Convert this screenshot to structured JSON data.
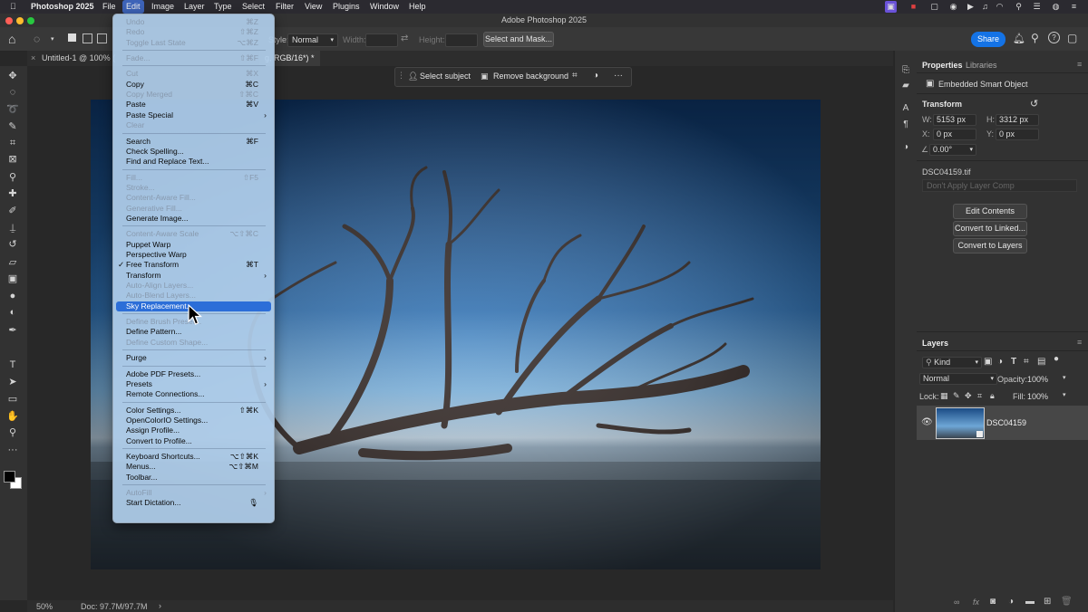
{
  "menubar": {
    "app": "Photoshop 2025",
    "items": [
      "File",
      "Edit",
      "Image",
      "Layer",
      "Type",
      "Select",
      "Filter",
      "View",
      "Plugins",
      "Window",
      "Help"
    ],
    "active": "Edit",
    "window_title": "Adobe Photoshop 2025"
  },
  "optionsbar": {
    "style_label": "Style:",
    "style_value": "Normal",
    "width_label": "Width:",
    "height_label": "Height:",
    "select_mask": "Select and Mask...",
    "share": "Share"
  },
  "document_tabs": [
    {
      "label": "Untitled-1 @ 100% (",
      "active": false
    },
    {
      "label": "g, RGB/16*) *",
      "active": true
    }
  ],
  "taskbar": {
    "select_subject": "Select subject",
    "remove_background": "Remove background"
  },
  "statusbar": {
    "zoom": "50%",
    "doc": "Doc: 97.7M/97.7M"
  },
  "properties": {
    "tabs": [
      "Properties",
      "Libraries"
    ],
    "object_type": "Embedded Smart Object",
    "section": "Transform",
    "w_label": "W:",
    "w_value": "5153 px",
    "h_label": "H:",
    "h_value": "3312 px",
    "x_label": "X:",
    "x_value": "0 px",
    "y_label": "Y:",
    "y_value": "0 px",
    "angle_value": "0.00°",
    "filename": "DSC04159.tif",
    "layer_comp": "Don't Apply Layer Comp",
    "buttons": [
      "Edit Contents",
      "Convert to Linked...",
      "Convert to Layers"
    ]
  },
  "layers": {
    "title": "Layers",
    "filter": "Kind",
    "blend_mode": "Normal",
    "opacity_label": "Opacity:",
    "opacity_value": "100%",
    "lock_label": "Lock:",
    "fill_label": "Fill:",
    "fill_value": "100%",
    "layer_name": "DSC04159"
  },
  "edit_menu": [
    {
      "label": "Undo",
      "shortcut": "⌘Z",
      "disabled": true
    },
    {
      "label": "Redo",
      "shortcut": "⇧⌘Z",
      "disabled": true
    },
    {
      "label": "Toggle Last State",
      "shortcut": "⌥⌘Z",
      "disabled": true
    },
    {
      "sep": true
    },
    {
      "label": "Fade...",
      "shortcut": "⇧⌘F",
      "disabled": true
    },
    {
      "sep": true
    },
    {
      "label": "Cut",
      "shortcut": "⌘X",
      "disabled": true
    },
    {
      "label": "Copy",
      "shortcut": "⌘C"
    },
    {
      "label": "Copy Merged",
      "shortcut": "⇧⌘C",
      "disabled": true
    },
    {
      "label": "Paste",
      "shortcut": "⌘V"
    },
    {
      "label": "Paste Special",
      "submenu": true
    },
    {
      "label": "Clear",
      "disabled": true
    },
    {
      "sep": true
    },
    {
      "label": "Search",
      "shortcut": "⌘F"
    },
    {
      "label": "Check Spelling..."
    },
    {
      "label": "Find and Replace Text..."
    },
    {
      "sep": true
    },
    {
      "label": "Fill...",
      "shortcut": "⇧F5",
      "disabled": true
    },
    {
      "label": "Stroke...",
      "disabled": true
    },
    {
      "label": "Content-Aware Fill...",
      "disabled": true
    },
    {
      "label": "Generative Fill...",
      "disabled": true
    },
    {
      "label": "Generate Image..."
    },
    {
      "sep": true
    },
    {
      "label": "Content-Aware Scale",
      "shortcut": "⌥⇧⌘C",
      "disabled": true
    },
    {
      "label": "Puppet Warp"
    },
    {
      "label": "Perspective Warp"
    },
    {
      "label": "Free Transform",
      "shortcut": "⌘T",
      "checked": true
    },
    {
      "label": "Transform",
      "submenu": true
    },
    {
      "label": "Auto-Align Layers...",
      "disabled": true
    },
    {
      "label": "Auto-Blend Layers...",
      "disabled": true
    },
    {
      "label": "Sky Replacement...",
      "highlighted": true
    },
    {
      "sep": true
    },
    {
      "label": "Define Brush Preset...",
      "disabled": true
    },
    {
      "label": "Define Pattern..."
    },
    {
      "label": "Define Custom Shape...",
      "disabled": true
    },
    {
      "sep": true
    },
    {
      "label": "Purge",
      "submenu": true
    },
    {
      "sep": true
    },
    {
      "label": "Adobe PDF Presets..."
    },
    {
      "label": "Presets",
      "submenu": true
    },
    {
      "label": "Remote Connections..."
    },
    {
      "sep": true
    },
    {
      "label": "Color Settings...",
      "shortcut": "⇧⌘K"
    },
    {
      "label": "OpenColorIO Settings..."
    },
    {
      "label": "Assign Profile..."
    },
    {
      "label": "Convert to Profile..."
    },
    {
      "sep": true
    },
    {
      "label": "Keyboard Shortcuts...",
      "shortcut": "⌥⇧⌘K"
    },
    {
      "label": "Menus...",
      "shortcut": "⌥⇧⌘M"
    },
    {
      "label": "Toolbar..."
    },
    {
      "sep": true
    },
    {
      "label": "AutoFill",
      "submenu": true,
      "disabled": true
    },
    {
      "label": "Start Dictation...",
      "shortcut": "🎙"
    }
  ],
  "tools": [
    {
      "icon": "move-icon",
      "glyph": "✥"
    },
    {
      "icon": "marquee-icon",
      "glyph": "◌"
    },
    {
      "icon": "lasso-icon",
      "glyph": "➰"
    },
    {
      "icon": "object-select-icon",
      "glyph": "✎"
    },
    {
      "icon": "crop-icon",
      "glyph": "⌗"
    },
    {
      "icon": "frame-icon",
      "glyph": "⊠"
    },
    {
      "icon": "eyedropper-icon",
      "glyph": "⚲"
    },
    {
      "icon": "healing-brush-icon",
      "glyph": "✚"
    },
    {
      "icon": "brush-icon",
      "glyph": "✐"
    },
    {
      "icon": "clone-stamp-icon",
      "glyph": "⍊"
    },
    {
      "icon": "history-brush-icon",
      "glyph": "↺"
    },
    {
      "icon": "eraser-icon",
      "glyph": "▱"
    },
    {
      "icon": "gradient-icon",
      "glyph": "▣"
    },
    {
      "icon": "blur-icon",
      "glyph": "●"
    },
    {
      "icon": "dodge-icon",
      "glyph": "◐"
    },
    {
      "icon": "pen-icon",
      "glyph": "✒"
    },
    {
      "icon": "type-icon",
      "glyph": "T"
    },
    {
      "icon": "path-select-icon",
      "glyph": "➤"
    },
    {
      "icon": "rectangle-icon",
      "glyph": "▭"
    },
    {
      "icon": "hand-icon",
      "glyph": "✋"
    },
    {
      "icon": "zoom-icon",
      "glyph": "⚲"
    },
    {
      "icon": "more-tools-icon",
      "glyph": "···"
    }
  ],
  "colors": {
    "menu_highlight": "#2c6ed8",
    "share_button": "#1473e6",
    "sky_top": "#0e3566",
    "sky_bottom": "#7ab3e0"
  }
}
